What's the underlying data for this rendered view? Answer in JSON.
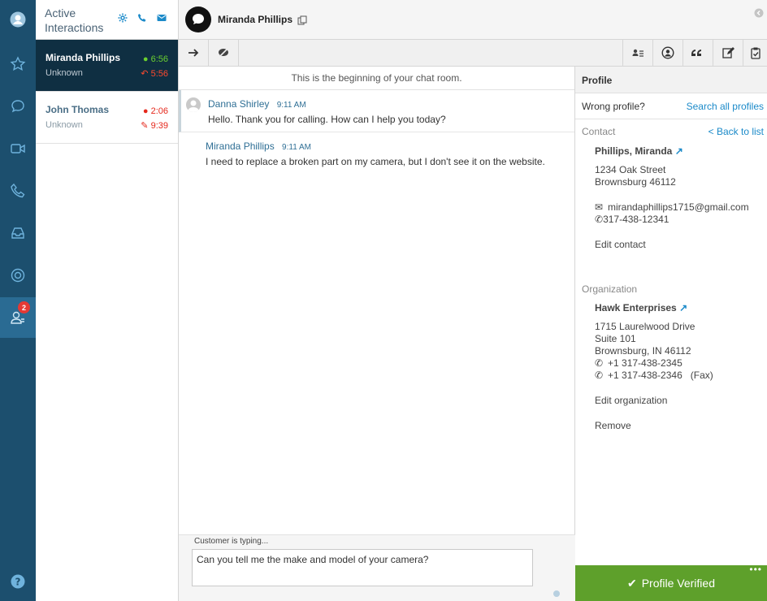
{
  "rail": {
    "badge_count": "2"
  },
  "interactions": {
    "title": "Active Interactions",
    "items": [
      {
        "name": "Miranda Phillips",
        "status": "Unknown",
        "time1": "6:56",
        "time2": "5:56"
      },
      {
        "name": "John Thomas",
        "status": "Unknown",
        "time1": "2:06",
        "time2": "9:39"
      }
    ]
  },
  "chat_header": {
    "name": "Miranda Phillips"
  },
  "chat": {
    "begin_text": "This is the beginning of your chat room.",
    "messages": [
      {
        "author": "Danna Shirley",
        "time": "9:11 AM",
        "text": "Hello. Thank you for calling. How can I help you today?"
      },
      {
        "author": "Miranda Phillips",
        "time": "9:11 AM",
        "text": "I need to replace a broken part on my camera, but I don't see it on the website."
      }
    ]
  },
  "composer": {
    "typing_status": "Customer is typing...",
    "value": "Can you tell me the make and model of your camera?"
  },
  "profile": {
    "title": "Profile",
    "wrong_profile": "Wrong profile?",
    "search_link": "Search all profiles",
    "contact_label": "Contact",
    "back_link": "< Back to list",
    "contact_name": "Phillips, Miranda",
    "address1": "1234 Oak Street",
    "address2": "Brownsburg 46112",
    "email": "mirandaphillips1715@gmail.com",
    "phone": "317-438-12341",
    "edit_contact": "Edit contact",
    "org_label": "Organization",
    "org_name": "Hawk Enterprises",
    "org_address1": "1715 Laurelwood Drive",
    "org_address2": "Suite 101",
    "org_address3": "Brownsburg, IN 46112",
    "org_phone": "+1 317-438-2345",
    "org_fax": "+1 317-438-2346",
    "fax_label": "(Fax)",
    "edit_org": "Edit organization",
    "remove": "Remove",
    "verified": "Profile Verified"
  },
  "colors": {
    "rail": "#1c4f6e",
    "selected_card": "#0f2f42",
    "link": "#1b8ac9",
    "verified": "#5ea02b"
  }
}
